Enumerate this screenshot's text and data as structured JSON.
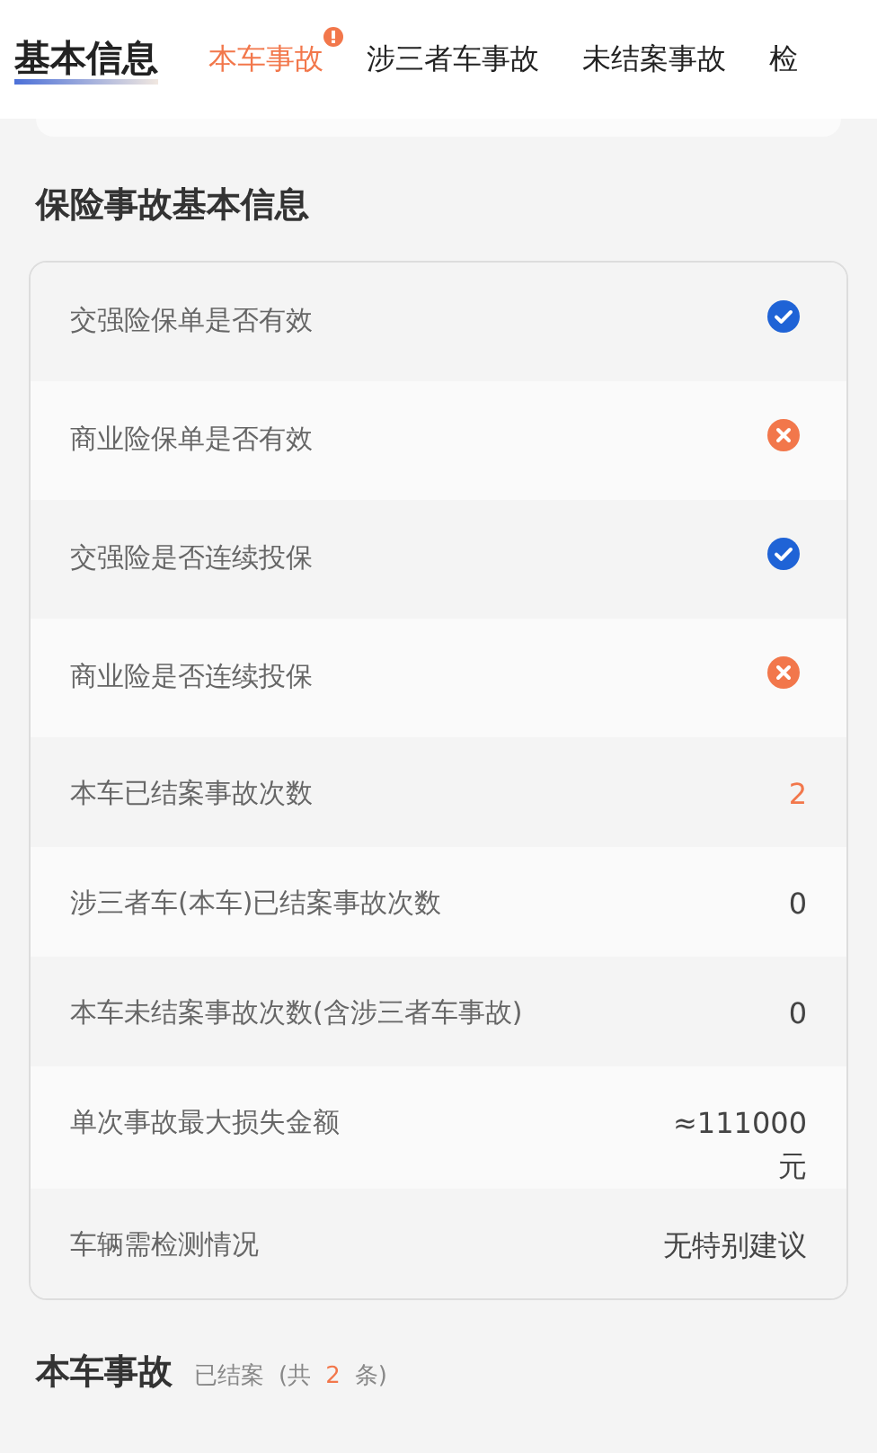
{
  "header": {
    "title": "基本信息",
    "tabs": [
      {
        "label": "本车事故",
        "selected": true,
        "alert": true
      },
      {
        "label": "涉三者车事故",
        "selected": false,
        "alert": false
      },
      {
        "label": "未结案事故",
        "selected": false,
        "alert": false
      },
      {
        "label": "检",
        "selected": false,
        "alert": false
      }
    ]
  },
  "section": {
    "title": "保险事故基本信息",
    "rows": [
      {
        "label": "交强险保单是否有效",
        "kind": "status",
        "valid": true
      },
      {
        "label": "商业险保单是否有效",
        "kind": "status",
        "valid": false
      },
      {
        "label": "交强险是否连续投保",
        "kind": "status",
        "valid": true
      },
      {
        "label": "商业险是否连续投保",
        "kind": "status",
        "valid": false
      },
      {
        "label": "本车已结案事故次数",
        "kind": "text",
        "value": "2",
        "highlight": true
      },
      {
        "label": "涉三者车(本车)已结案事故次数",
        "kind": "text",
        "value": "0",
        "highlight": false
      },
      {
        "label": "本车未结案事故次数(含涉三者车事故)",
        "kind": "text",
        "value": "0",
        "highlight": false
      },
      {
        "label": "单次事故最大损失金额",
        "kind": "text",
        "value": "≈111000 元",
        "highlight": false
      },
      {
        "label": "车辆需检测情况",
        "kind": "text",
        "value": "无特别建议",
        "highlight": false
      }
    ]
  },
  "footer": {
    "title": "本车事故",
    "status": "已结案",
    "count_prefix": "(共",
    "count": "2",
    "count_suffix": "条)"
  }
}
